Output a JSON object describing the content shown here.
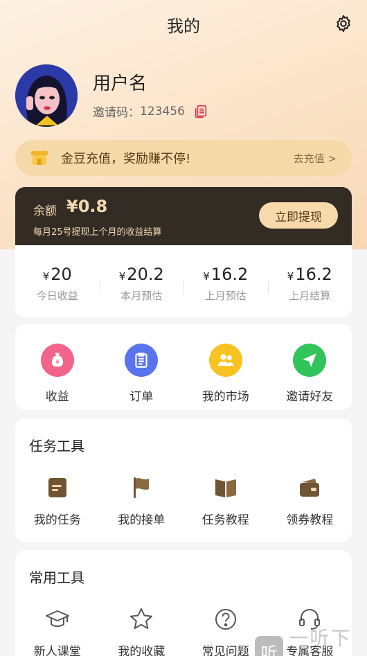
{
  "header": {
    "title": "我的"
  },
  "profile": {
    "username": "用户名",
    "invite_label": "邀请码：",
    "invite_code": "123456"
  },
  "banner": {
    "text": "金豆充值，奖励赚不停!",
    "link": "去充值 >"
  },
  "balance": {
    "label": "余额",
    "value": "¥0.8",
    "note": "每月25号提现上个月的收益结算",
    "withdraw_label": "立即提现"
  },
  "stats": [
    {
      "currency": "¥",
      "value": "20",
      "label": "今日收益"
    },
    {
      "currency": "¥",
      "value": "20.2",
      "label": "本月预估"
    },
    {
      "currency": "¥",
      "value": "16.2",
      "label": "上月预估"
    },
    {
      "currency": "¥",
      "value": "16.2",
      "label": "上月结算"
    }
  ],
  "quick_actions": [
    {
      "label": "收益",
      "icon": "money-bag-icon",
      "color": "#f2648a"
    },
    {
      "label": "订单",
      "icon": "clipboard-icon",
      "color": "#5a74f0"
    },
    {
      "label": "我的市场",
      "icon": "users-icon",
      "color": "#f8c322"
    },
    {
      "label": "邀请好友",
      "icon": "send-icon",
      "color": "#31c45a"
    }
  ],
  "task_tools": {
    "title": "任务工具",
    "items": [
      {
        "label": "我的任务",
        "icon": "task-icon"
      },
      {
        "label": "我的接单",
        "icon": "flag-icon"
      },
      {
        "label": "任务教程",
        "icon": "book-icon"
      },
      {
        "label": "领券教程",
        "icon": "wallet-icon"
      }
    ]
  },
  "common_tools": {
    "title": "常用工具",
    "items": [
      {
        "label": "新人课堂",
        "icon": "graduation-cap-icon"
      },
      {
        "label": "我的收藏",
        "icon": "star-icon"
      },
      {
        "label": "常见问题",
        "icon": "question-icon"
      },
      {
        "label": "专属客服",
        "icon": "headset-icon"
      }
    ]
  },
  "watermark": {
    "glyph": "听",
    "text": "一听下载"
  },
  "colors": {
    "accent": "#f6d9a9",
    "dark_card": "#332c25",
    "gold_text": "#f3d9b1",
    "tool_brown": "#6f5434"
  }
}
